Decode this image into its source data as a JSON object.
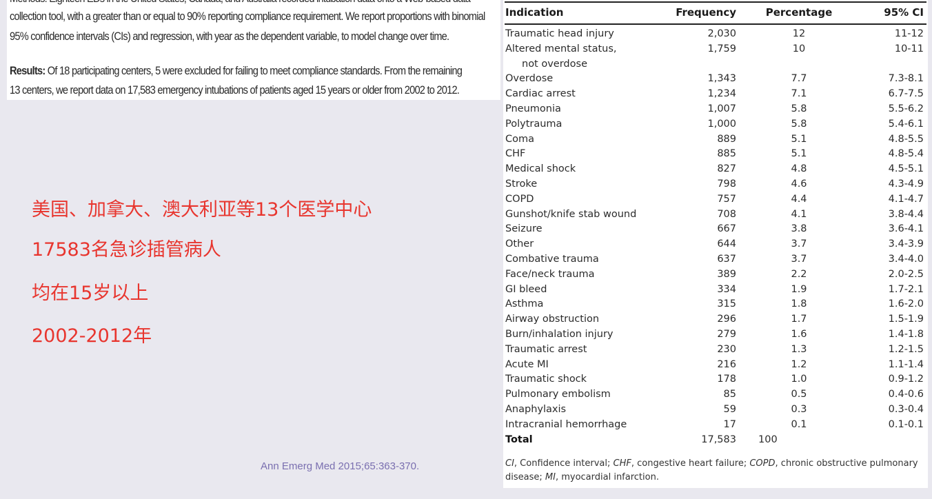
{
  "abstract": {
    "methods_line_partial": "Methods: Eighteen EDs in the United States, Canada, and Australia recorded intubation data onto a Web-based data",
    "methods_line_2": "collection tool, with a greater than or equal to 90% reporting compliance requirement. We report proportions with binomial",
    "methods_line_3": "95% confidence intervals (CIs) and regression, with year as the dependent variable, to model change over time.",
    "results_label": "Results:",
    "results_line_1": " Of 18 participating centers, 5 were excluded for failing to meet compliance standards. From the remaining",
    "results_line_2": "13 centers, we report data on 17,583 emergency intubations of patients aged 15 years or older from 2002 to 2012."
  },
  "annotations": {
    "line_1": "美国、加拿大、澳大利亚等13个医学中心",
    "line_2": "17583名急诊插管病人",
    "line_3": "均在15岁以上",
    "line_4": "2002-2012年",
    "color": "#e8352e"
  },
  "citation": "Ann Emerg Med 2015;65:363-370.",
  "table": {
    "headers": [
      "Indication",
      "Frequency",
      "Percentage",
      "95% CI"
    ],
    "rows": [
      {
        "indication": "Traumatic head injury",
        "frequency": "2,030",
        "percentage": "12",
        "ci": "11-12"
      },
      {
        "indication": "Altered mental status,",
        "indication_cont": "not overdose",
        "frequency": "1,759",
        "percentage": "10",
        "ci": "10-11"
      },
      {
        "indication": "Overdose",
        "frequency": "1,343",
        "percentage": "7.7",
        "ci": "7.3-8.1"
      },
      {
        "indication": "Cardiac arrest",
        "frequency": "1,234",
        "percentage": "7.1",
        "ci": "6.7-7.5"
      },
      {
        "indication": "Pneumonia",
        "frequency": "1,007",
        "percentage": "5.8",
        "ci": "5.5-6.2"
      },
      {
        "indication": "Polytrauma",
        "frequency": "1,000",
        "percentage": "5.8",
        "ci": "5.4-6.1"
      },
      {
        "indication": "Coma",
        "frequency": "889",
        "percentage": "5.1",
        "ci": "4.8-5.5"
      },
      {
        "indication": "CHF",
        "frequency": "885",
        "percentage": "5.1",
        "ci": "4.8-5.4"
      },
      {
        "indication": "Medical shock",
        "frequency": "827",
        "percentage": "4.8",
        "ci": "4.5-5.1"
      },
      {
        "indication": "Stroke",
        "frequency": "798",
        "percentage": "4.6",
        "ci": "4.3-4.9"
      },
      {
        "indication": "COPD",
        "frequency": "757",
        "percentage": "4.4",
        "ci": "4.1-4.7"
      },
      {
        "indication": "Gunshot/knife stab wound",
        "frequency": "708",
        "percentage": "4.1",
        "ci": "3.8-4.4"
      },
      {
        "indication": "Seizure",
        "frequency": "667",
        "percentage": "3.8",
        "ci": "3.6-4.1"
      },
      {
        "indication": "Other",
        "frequency": "644",
        "percentage": "3.7",
        "ci": "3.4-3.9"
      },
      {
        "indication": "Combative trauma",
        "frequency": "637",
        "percentage": "3.7",
        "ci": "3.4-4.0"
      },
      {
        "indication": "Face/neck trauma",
        "frequency": "389",
        "percentage": "2.2",
        "ci": "2.0-2.5"
      },
      {
        "indication": "GI bleed",
        "frequency": "334",
        "percentage": "1.9",
        "ci": "1.7-2.1"
      },
      {
        "indication": "Asthma",
        "frequency": "315",
        "percentage": "1.8",
        "ci": "1.6-2.0"
      },
      {
        "indication": "Airway obstruction",
        "frequency": "296",
        "percentage": "1.7",
        "ci": "1.5-1.9"
      },
      {
        "indication": "Burn/inhalation injury",
        "frequency": "279",
        "percentage": "1.6",
        "ci": "1.4-1.8"
      },
      {
        "indication": "Traumatic arrest",
        "frequency": "230",
        "percentage": "1.3",
        "ci": "1.2-1.5"
      },
      {
        "indication": "Acute MI",
        "frequency": "216",
        "percentage": "1.2",
        "ci": "1.1-1.4"
      },
      {
        "indication": "Traumatic shock",
        "frequency": "178",
        "percentage": "1.0",
        "ci": "0.9-1.2"
      },
      {
        "indication": "Pulmonary embolism",
        "frequency": "85",
        "percentage": "0.5",
        "ci": "0.4-0.6"
      },
      {
        "indication": "Anaphylaxis",
        "frequency": "59",
        "percentage": "0.3",
        "ci": "0.3-0.4"
      },
      {
        "indication": "Intracranial hemorrhage",
        "frequency": "17",
        "percentage": "0.1",
        "ci": "0.1-0.1"
      }
    ],
    "total": {
      "indication": "Total",
      "frequency": "17,583",
      "percentage": "100",
      "ci": ""
    },
    "footnote": {
      "ci_abbr": "CI",
      "ci_def": ", Confidence interval; ",
      "chf_abbr": "CHF",
      "chf_def": ", congestive heart failure; ",
      "copd_abbr": "COPD",
      "copd_def": ", chronic obstructive pulmonary disease; ",
      "mi_abbr": "MI",
      "mi_def": ", myocardial infarction."
    }
  }
}
